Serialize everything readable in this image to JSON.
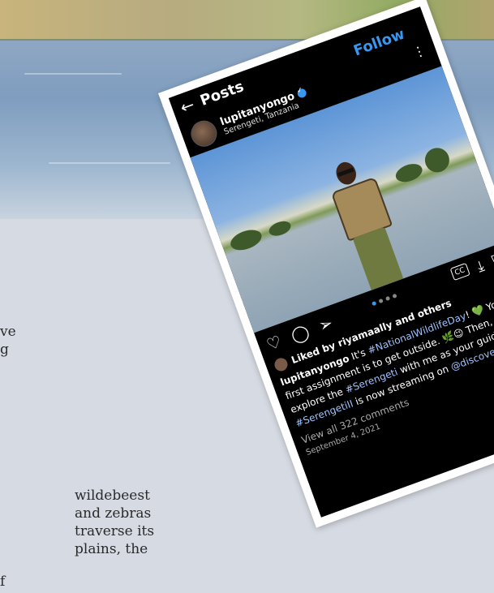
{
  "article": {
    "left_fragments": [
      "ve",
      "g",
      "f"
    ],
    "body_lines": [
      "wildebeest",
      "and zebras",
      "traverse its",
      "plains, the"
    ]
  },
  "post": {
    "header_title": "Posts",
    "follow_label": "Follow",
    "username": "lupitanyongo",
    "location": "Serengeti, Tanzania",
    "liked_by": "Liked by riyamaally and others",
    "caption_user": "lupitanyongo",
    "caption_parts": [
      {
        "text": " It's ",
        "type": "text"
      },
      {
        "text": "#NationalWildlifeDay",
        "type": "tag"
      },
      {
        "text": "! 💚 Your first assignment is to get outside. 🌿😉 Then, explore the ",
        "type": "text"
      },
      {
        "text": "#Serengeti",
        "type": "tag"
      },
      {
        "text": " with me as your guide. 🐘 ",
        "type": "text"
      },
      {
        "text": "#SerengetiII",
        "type": "tag"
      },
      {
        "text": " is now streaming on ",
        "type": "text"
      },
      {
        "text": "@discoveryplus",
        "type": "tag"
      },
      {
        "text": ".",
        "type": "text"
      }
    ],
    "view_comments": "View all 322 comments",
    "date": "September 4, 2021",
    "carousel": {
      "count": 4,
      "active": 0
    }
  },
  "icons": {
    "back": "back-arrow-icon",
    "more": "more-vertical-icon",
    "like": "heart-icon",
    "comment": "comment-icon",
    "share": "share-icon",
    "captions": "closed-captions-icon",
    "download": "download-icon",
    "save": "bookmark-icon"
  },
  "colors": {
    "accent": "#3897f0",
    "screen": "#000000",
    "tag": "#9ec3ff"
  }
}
